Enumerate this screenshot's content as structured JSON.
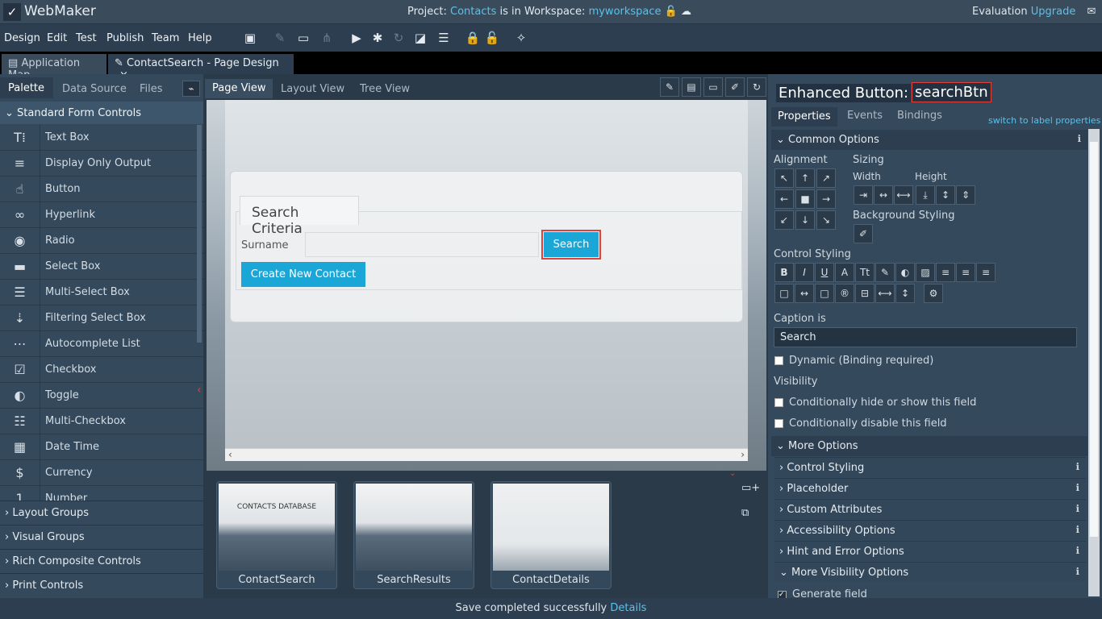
{
  "titlebar": {
    "app_name": "WebMaker",
    "project_prefix": "Project:",
    "project_name": "Contacts",
    "workspace_text": "is in Workspace:",
    "workspace_name": "myworkspace",
    "evaluation": "Evaluation",
    "upgrade": "Upgrade"
  },
  "menu": [
    "Design",
    "Edit",
    "Test",
    "Publish",
    "Team",
    "Help"
  ],
  "doc_tabs": {
    "app_map": "Application Map",
    "page_design": "ContactSearch - Page Design",
    "close": "×"
  },
  "palette": {
    "tabs": [
      "Palette",
      "Data Source",
      "Files"
    ],
    "section": "Standard Form Controls",
    "items": [
      {
        "label": "Text Box",
        "icon": "text-box-icon",
        "glyph": "T⁞"
      },
      {
        "label": "Display Only Output",
        "icon": "display-output-icon",
        "glyph": "≡"
      },
      {
        "label": "Button",
        "icon": "hand-pointer-icon",
        "glyph": "☝"
      },
      {
        "label": "Hyperlink",
        "icon": "link-icon",
        "glyph": "∞"
      },
      {
        "label": "Radio",
        "icon": "radio-icon",
        "glyph": "◉"
      },
      {
        "label": "Select Box",
        "icon": "select-box-icon",
        "glyph": "▬"
      },
      {
        "label": "Multi-Select Box",
        "icon": "multi-select-icon",
        "glyph": "☰"
      },
      {
        "label": "Filtering Select Box",
        "icon": "filter-select-icon",
        "glyph": "⇣"
      },
      {
        "label": "Autocomplete List",
        "icon": "autocomplete-icon",
        "glyph": "⋯"
      },
      {
        "label": "Checkbox",
        "icon": "checkbox-icon",
        "glyph": "☑"
      },
      {
        "label": "Toggle",
        "icon": "toggle-icon",
        "glyph": "◐"
      },
      {
        "label": "Multi-Checkbox",
        "icon": "multi-checkbox-icon",
        "glyph": "☷"
      },
      {
        "label": "Date Time",
        "icon": "calendar-icon",
        "glyph": "▦"
      },
      {
        "label": "Currency",
        "icon": "currency-icon",
        "glyph": "$"
      },
      {
        "label": "Number",
        "icon": "number-icon",
        "glyph": "1"
      }
    ],
    "groups": [
      "Layout Groups",
      "Visual Groups",
      "Rich Composite Controls",
      "Print Controls"
    ]
  },
  "views": [
    "Page View",
    "Layout View",
    "Tree View"
  ],
  "form": {
    "legend": "Search Criteria",
    "surname_label": "Surname",
    "search_button": "Search",
    "create_button": "Create New Contact"
  },
  "thumbnails": [
    {
      "name": "ContactSearch",
      "title": "CONTACTS DATABASE"
    },
    {
      "name": "SearchResults"
    },
    {
      "name": "ContactDetails"
    }
  ],
  "properties": {
    "control_type": "Enhanced Button:",
    "control_name": "searchBtn",
    "tabs": [
      "Properties",
      "Events",
      "Bindings"
    ],
    "switch_link": "switch to label properties",
    "common_options": "Common Options",
    "alignment": "Alignment",
    "sizing": "Sizing",
    "width": "Width",
    "height": "Height",
    "background_styling": "Background Styling",
    "control_styling": "Control Styling",
    "caption_is": "Caption is",
    "caption_value": "Search",
    "dynamic": "Dynamic (Binding required)",
    "visibility": "Visibility",
    "cond_hide": "Conditionally hide or show this field",
    "cond_disable": "Conditionally disable this field",
    "more_options": "More Options",
    "subsections": [
      "Control Styling",
      "Placeholder",
      "Custom Attributes",
      "Accessibility Options",
      "Hint and Error Options",
      "More Visibility Options"
    ],
    "generate_field": "Generate field"
  },
  "status": {
    "message": "Save completed successfully",
    "details": "Details"
  }
}
